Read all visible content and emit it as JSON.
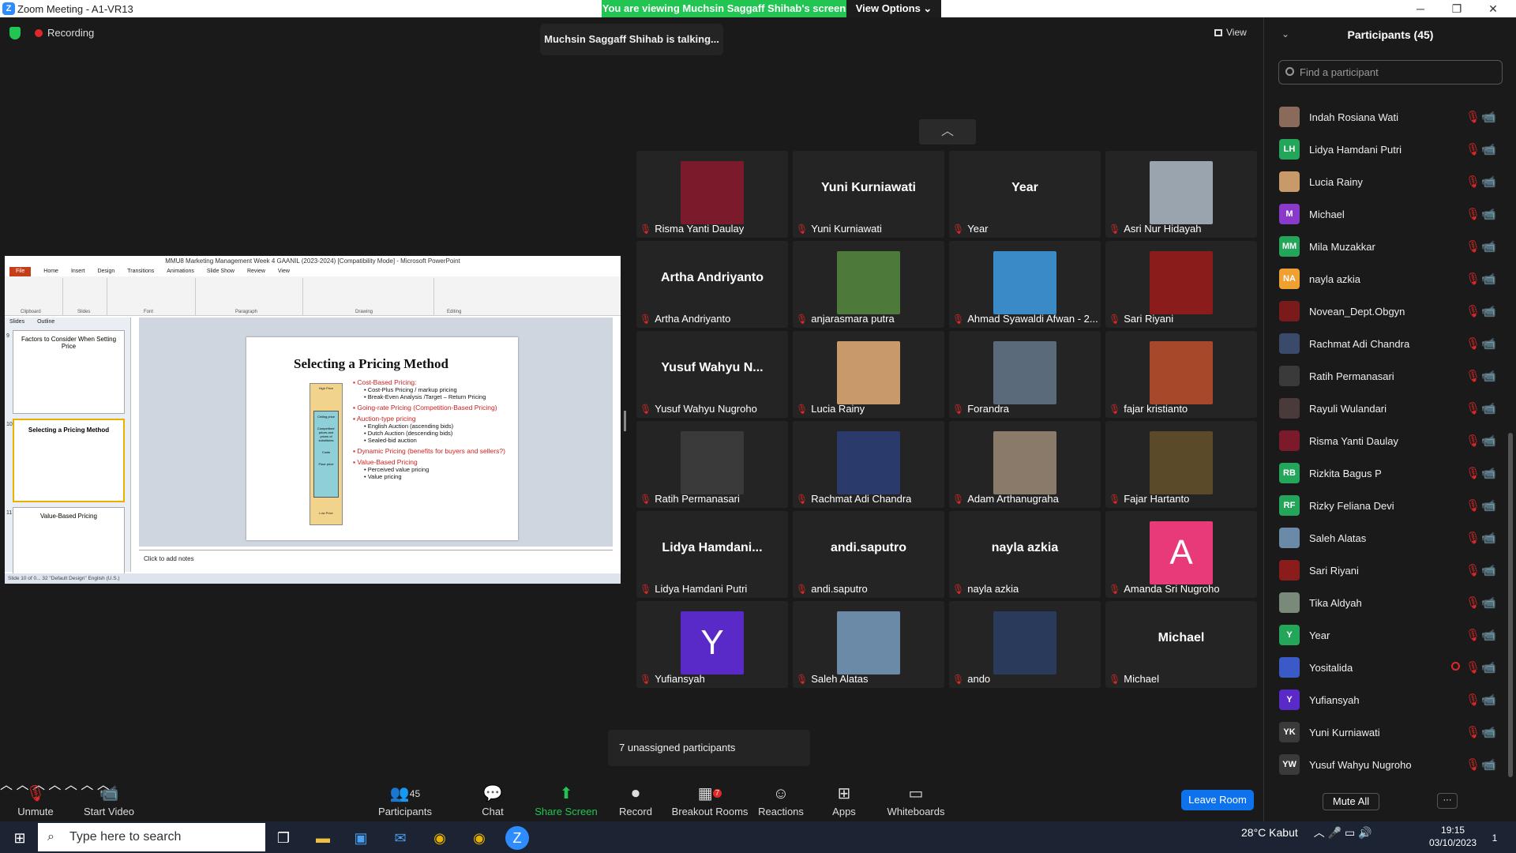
{
  "window": {
    "title": "Zoom Meeting - A1-VR13",
    "minimize": "─",
    "maximize": "❐",
    "close": "✕"
  },
  "banner": {
    "text": "You are viewing Muchsin Saggaff Shihab's screen",
    "options": "View Options ⌄"
  },
  "recording_label": "Recording",
  "talking": "Muchsin Saggaff Shihab is talking...",
  "view_label": "View",
  "ppt": {
    "title": "MMU8 Marketing Management Week 4 GAANIL (2023-2024) [Compatibility Mode] - Microsoft PowerPoint",
    "tabs": [
      "File",
      "Home",
      "Insert",
      "Design",
      "Transitions",
      "Animations",
      "Slide Show",
      "Review",
      "View"
    ],
    "groups": [
      "Clipboard",
      "Slides",
      "Font",
      "Paragraph",
      "Drawing",
      "Editing"
    ],
    "panel_tabs": [
      "Slides",
      "Outline"
    ],
    "slides": [
      {
        "num": "9",
        "title": "Factors to Consider When Setting Price"
      },
      {
        "num": "10",
        "title": "Selecting a Pricing Method"
      },
      {
        "num": "11",
        "title": "Value-Based Pricing"
      }
    ],
    "slide_title": "Selecting a Pricing Method",
    "bullets": [
      {
        "t": "Cost-Based Pricing:",
        "k": "r"
      },
      {
        "t": "Cost-Plus Pricing / markup pricing",
        "k": "s"
      },
      {
        "t": "Break-Even Analysis /Target – Return Pricing",
        "k": "s"
      },
      {
        "t": "Going-rate Pricing (Competition-Based Pricing)",
        "k": "r"
      },
      {
        "t": "Auction-type pricing",
        "k": "r"
      },
      {
        "t": "English Auction (ascending bids)",
        "k": "s"
      },
      {
        "t": "Dutch Auction (descending bids)",
        "k": "s"
      },
      {
        "t": "Sealed-bid auction",
        "k": "s"
      },
      {
        "t": "Dynamic Pricing (benefits for buyers and sellers?)",
        "k": "r"
      },
      {
        "t": "Value-Based Pricing",
        "k": "r"
      },
      {
        "t": "Perceived value pricing",
        "k": "s"
      },
      {
        "t": "Value pricing",
        "k": "s"
      }
    ],
    "bar_labels": [
      "High Price",
      "Ceiling price",
      "Competitors' prices and prices of substitutes",
      "Costs",
      "Floor price",
      "Low Price"
    ],
    "notes": "Click to add notes",
    "status": "Slide 10 of 0... 32    \"Default Design\"    English (U.S.)"
  },
  "tiles": [
    {
      "name": "Risma Yanti Daulay",
      "big": "",
      "pic": "#7a1a2a"
    },
    {
      "name": "Yuni Kurniawati",
      "big": "Yuni Kurniawati",
      "pic": ""
    },
    {
      "name": "Year",
      "big": "Year",
      "pic": ""
    },
    {
      "name": "Asri Nur Hidayah",
      "big": "",
      "pic": "#9aa4ae"
    },
    {
      "name": "Artha Andriyanto",
      "big": "Artha Andriyanto",
      "pic": ""
    },
    {
      "name": "anjarasmara putra",
      "big": "",
      "pic": "#4d7a3a"
    },
    {
      "name": "Ahmad Syawaldi Afwan - 2...",
      "big": "",
      "pic": "#3a8ac8"
    },
    {
      "name": "Sari Riyani",
      "big": "",
      "pic": "#8a1c1c"
    },
    {
      "name": "Yusuf Wahyu Nugroho",
      "big": "Yusuf Wahyu N...",
      "pic": ""
    },
    {
      "name": "Lucia Rainy",
      "big": "",
      "pic": "#c89a6a"
    },
    {
      "name": "Forandra",
      "big": "",
      "pic": "#5a6a7a"
    },
    {
      "name": "fajar kristianto",
      "big": "",
      "pic": "#a8482a"
    },
    {
      "name": "Ratih Permanasari",
      "big": "",
      "pic": "#3a3a3a"
    },
    {
      "name": "Rachmat Adi Chandra",
      "big": "",
      "pic": "#2a3a6a"
    },
    {
      "name": "Adam Arthanugraha",
      "big": "",
      "pic": "#8a7a6a"
    },
    {
      "name": "Fajar Hartanto",
      "big": "",
      "pic": "#5a4a2a"
    },
    {
      "name": "Lidya Hamdani Putri",
      "big": "Lidya  Hamdani...",
      "pic": ""
    },
    {
      "name": "andi.saputro",
      "big": "andi.saputro",
      "pic": ""
    },
    {
      "name": "nayla azkia",
      "big": "nayla azkia",
      "pic": ""
    },
    {
      "name": "Amanda Sri Nugroho",
      "big": "",
      "pic": "#e83a78",
      "letter": "A"
    },
    {
      "name": "Yufiansyah",
      "big": "",
      "pic": "#5a2ac8",
      "letter": "Y"
    },
    {
      "name": "Saleh Alatas",
      "big": "",
      "pic": "#6a8aa8"
    },
    {
      "name": "ando",
      "big": "",
      "pic": "#2a3a5a"
    },
    {
      "name": "Michael",
      "big": "Michael",
      "pic": ""
    }
  ],
  "up_arrow": "︿",
  "unassigned": "7 unassigned participants",
  "toolbar": {
    "unmute": "Unmute",
    "video": "Start Video",
    "participants": "Participants",
    "participants_count": "45",
    "chat": "Chat",
    "share": "Share Screen",
    "record": "Record",
    "breakout": "Breakout Rooms",
    "breakout_badge": "7",
    "reactions": "Reactions",
    "apps": "Apps",
    "whiteboards": "Whiteboards",
    "leave": "Leave Room"
  },
  "panel": {
    "title": "Participants (45)",
    "search_placeholder": "Find a participant",
    "mute_all": "Mute All",
    "more": "···",
    "participants": [
      {
        "name": "Indah Rosiana Wati",
        "init": "",
        "color": "#8a6a5a",
        "video": "off"
      },
      {
        "name": "Lidya Hamdani Putri",
        "init": "LH",
        "color": "#23a55a",
        "video": "off"
      },
      {
        "name": "Lucia Rainy",
        "init": "",
        "color": "#c89a6a",
        "video": "off"
      },
      {
        "name": "Michael",
        "init": "M",
        "color": "#8a3ac8",
        "video": "off"
      },
      {
        "name": "Mila Muzakkar",
        "init": "MM",
        "color": "#23a55a",
        "video": "on"
      },
      {
        "name": "nayla azkia",
        "init": "NA",
        "color": "#f0a030",
        "video": "off"
      },
      {
        "name": "Novean_Dept.Obgyn",
        "init": "",
        "color": "#7a1a1a",
        "video": "on"
      },
      {
        "name": "Rachmat Adi Chandra",
        "init": "",
        "color": "#3a4a6a",
        "video": "off"
      },
      {
        "name": "Ratih Permanasari",
        "init": "",
        "color": "#3a3a3a",
        "video": "off"
      },
      {
        "name": "Rayuli Wulandari",
        "init": "",
        "color": "#4a3a3a",
        "video": "off"
      },
      {
        "name": "Risma Yanti Daulay",
        "init": "",
        "color": "#7a1a2a",
        "video": "off"
      },
      {
        "name": "Rizkita Bagus P",
        "init": "RB",
        "color": "#23a55a",
        "video": "off"
      },
      {
        "name": "Rizky Feliana Devi",
        "init": "RF",
        "color": "#23a55a",
        "video": "off"
      },
      {
        "name": "Saleh Alatas",
        "init": "",
        "color": "#6a8aa8",
        "video": "off"
      },
      {
        "name": "Sari Riyani",
        "init": "",
        "color": "#8a1c1c",
        "video": "off"
      },
      {
        "name": "Tika Aldyah",
        "init": "",
        "color": "#7a8a7a",
        "video": "on"
      },
      {
        "name": "Year",
        "init": "Y",
        "color": "#23a55a",
        "video": "off"
      },
      {
        "name": "Yositalida",
        "init": "",
        "color": "#3a5ac8",
        "video": "on",
        "rec": true
      },
      {
        "name": "Yufiansyah",
        "init": "Y",
        "color": "#5a2ac8",
        "video": "off"
      },
      {
        "name": "Yuni Kurniawati",
        "init": "YK",
        "color": "#3a3a3a",
        "video": "off"
      },
      {
        "name": "Yusuf Wahyu Nugroho",
        "init": "YW",
        "color": "#3a3a3a",
        "video": "off"
      }
    ]
  },
  "taskbar": {
    "search": "Type here to search",
    "weather": "28°C  Kabut",
    "time": "19:15",
    "date": "03/10/2023",
    "notif": "1"
  }
}
